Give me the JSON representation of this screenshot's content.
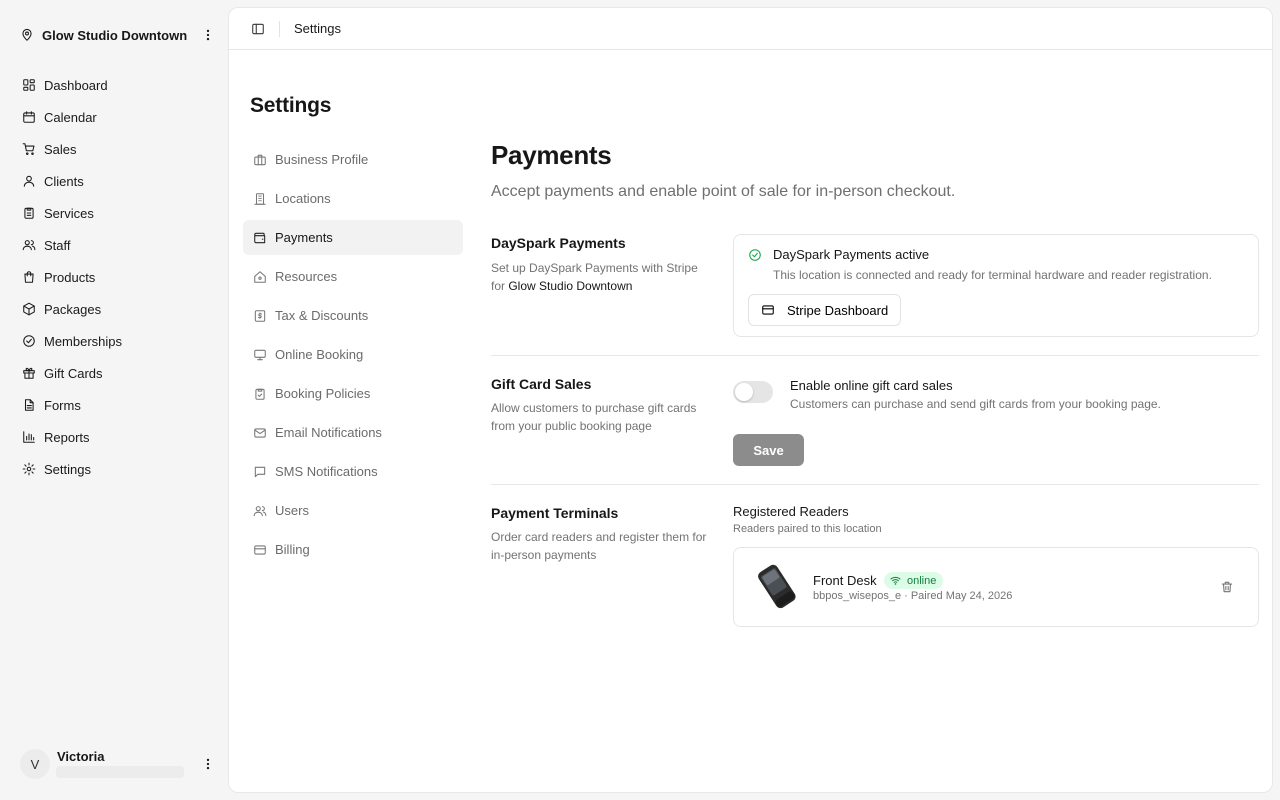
{
  "sidebar": {
    "location_name": "Glow Studio Downtown",
    "items": [
      {
        "label": "Dashboard",
        "icon": "dashboard-icon"
      },
      {
        "label": "Calendar",
        "icon": "calendar-icon"
      },
      {
        "label": "Sales",
        "icon": "cart-icon"
      },
      {
        "label": "Clients",
        "icon": "user-icon"
      },
      {
        "label": "Services",
        "icon": "clipboard-icon"
      },
      {
        "label": "Staff",
        "icon": "users-icon"
      },
      {
        "label": "Products",
        "icon": "shopping-bag-icon"
      },
      {
        "label": "Packages",
        "icon": "package-icon"
      },
      {
        "label": "Memberships",
        "icon": "badge-check-icon"
      },
      {
        "label": "Gift Cards",
        "icon": "gift-icon"
      },
      {
        "label": "Forms",
        "icon": "file-text-icon"
      },
      {
        "label": "Reports",
        "icon": "bar-chart-icon"
      },
      {
        "label": "Settings",
        "icon": "gear-icon"
      }
    ],
    "user": {
      "initial": "V",
      "name": "Victoria"
    }
  },
  "topbar": {
    "breadcrumb": "Settings"
  },
  "settings": {
    "title": "Settings",
    "nav": [
      {
        "label": "Business Profile",
        "icon": "briefcase-icon"
      },
      {
        "label": "Locations",
        "icon": "building-icon"
      },
      {
        "label": "Payments",
        "icon": "wallet-icon",
        "active": true
      },
      {
        "label": "Resources",
        "icon": "home-icon"
      },
      {
        "label": "Tax & Discounts",
        "icon": "receipt-icon"
      },
      {
        "label": "Online Booking",
        "icon": "monitor-icon"
      },
      {
        "label": "Booking Policies",
        "icon": "clipboard-check-icon"
      },
      {
        "label": "Email Notifications",
        "icon": "mail-icon"
      },
      {
        "label": "SMS Notifications",
        "icon": "message-icon"
      },
      {
        "label": "Users",
        "icon": "users-icon"
      },
      {
        "label": "Billing",
        "icon": "credit-card-icon"
      }
    ]
  },
  "payments": {
    "title": "Payments",
    "description": "Accept payments and enable point of sale for in-person checkout.",
    "dayspark": {
      "title": "DaySpark Payments",
      "desc_prefix": "Set up DaySpark Payments with Stripe for ",
      "desc_location": "Glow Studio Downtown",
      "status_label": "DaySpark Payments active",
      "status_sub": "This location is connected and ready for terminal hardware and reader registration.",
      "stripe_button": "Stripe Dashboard",
      "status_color": "#16a34a"
    },
    "gift_cards": {
      "title": "Gift Card Sales",
      "desc": "Allow customers to purchase gift cards from your public booking page",
      "toggle_label": "Enable online gift card sales",
      "toggle_sub": "Customers can purchase and send gift cards from your booking page.",
      "enabled": false,
      "save_label": "Save"
    },
    "terminals": {
      "title": "Payment Terminals",
      "desc": "Order card readers and register them for in-person payments",
      "readers_title": "Registered Readers",
      "readers_sub": "Readers paired to this location",
      "readers": [
        {
          "name": "Front Desk",
          "status": "online",
          "meta": "bbpos_wisepos_e · Paired May 24, 2026"
        }
      ],
      "online_color": "#15803d"
    }
  }
}
